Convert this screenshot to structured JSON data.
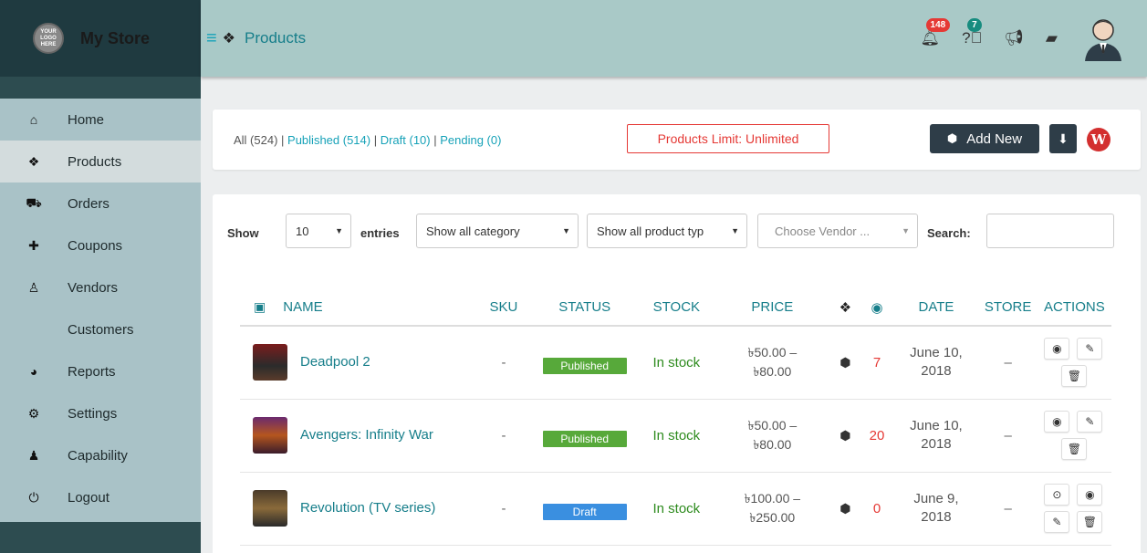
{
  "brand": {
    "logo_text": "YOUR LOGO HERE",
    "store_name": "My Store"
  },
  "sidebar": {
    "items": [
      {
        "label": "Home",
        "icon": "home-icon",
        "glyph": "⌂",
        "active": false
      },
      {
        "label": "Products",
        "icon": "cubes-icon",
        "glyph": "❖",
        "active": true
      },
      {
        "label": "Orders",
        "icon": "cart-icon",
        "glyph": "⛟",
        "active": false
      },
      {
        "label": "Coupons",
        "icon": "gift-icon",
        "glyph": "✚",
        "active": false
      },
      {
        "label": "Vendors",
        "icon": "user-icon",
        "glyph": "♙",
        "active": false
      },
      {
        "label": "Customers",
        "icon": "",
        "glyph": "",
        "active": false
      },
      {
        "label": "Reports",
        "icon": "pie-chart-icon",
        "glyph": "◕",
        "active": false
      },
      {
        "label": "Settings",
        "icon": "cogs-icon",
        "glyph": "⚙",
        "active": false
      },
      {
        "label": "Capability",
        "icon": "user-times-icon",
        "glyph": "♟",
        "active": false
      },
      {
        "label": "Logout",
        "icon": "power-icon",
        "glyph": "⏻",
        "active": false
      }
    ]
  },
  "header": {
    "title": "Products",
    "notifications_count": "148",
    "help_count": "7"
  },
  "filter": {
    "all": "All (524)",
    "sep": " | ",
    "published": "Published (514)",
    "draft": "Draft (10)",
    "pending": "Pending (0)",
    "limit": "Products Limit: Unlimited",
    "add_new": "Add New"
  },
  "controls": {
    "show": "Show",
    "entries_value": "10",
    "entries": "entries",
    "category": "Show all category",
    "product_type": "Show all product typ",
    "vendor_placeholder": "Choose Vendor ...",
    "search": "Search:"
  },
  "table": {
    "headers": {
      "name": "NAME",
      "sku": "SKU",
      "status": "STATUS",
      "stock": "STOCK",
      "price": "PRICE",
      "date": "DATE",
      "store": "STORE",
      "actions": "ACTIONS"
    },
    "rows": [
      {
        "name": "Deadpool 2",
        "sku": "-",
        "status": "Published",
        "stock": "In stock",
        "price_low": "৳50.00 –",
        "price_high": "৳80.00",
        "views": "7",
        "date_line1": "June 10,",
        "date_line2": "2018",
        "store": "–"
      },
      {
        "name": "Avengers: Infinity War",
        "sku": "-",
        "status": "Published",
        "stock": "In stock",
        "price_low": "৳50.00 –",
        "price_high": "৳80.00",
        "views": "20",
        "date_line1": "June 10,",
        "date_line2": "2018",
        "store": "–"
      },
      {
        "name": "Revolution (TV series)",
        "sku": "-",
        "status": "Draft",
        "stock": "In stock",
        "price_low": "৳100.00 –",
        "price_high": "৳250.00",
        "views": "0",
        "date_line1": "June 9,",
        "date_line2": "2018",
        "store": "–"
      }
    ]
  },
  "colors": {
    "sidebar_bg": "#a9c2c7",
    "brand_bg": "#1f3a40",
    "accent": "#17a2b8",
    "published": "#57a93a",
    "draft": "#3a8fe0",
    "danger": "#e53935"
  }
}
